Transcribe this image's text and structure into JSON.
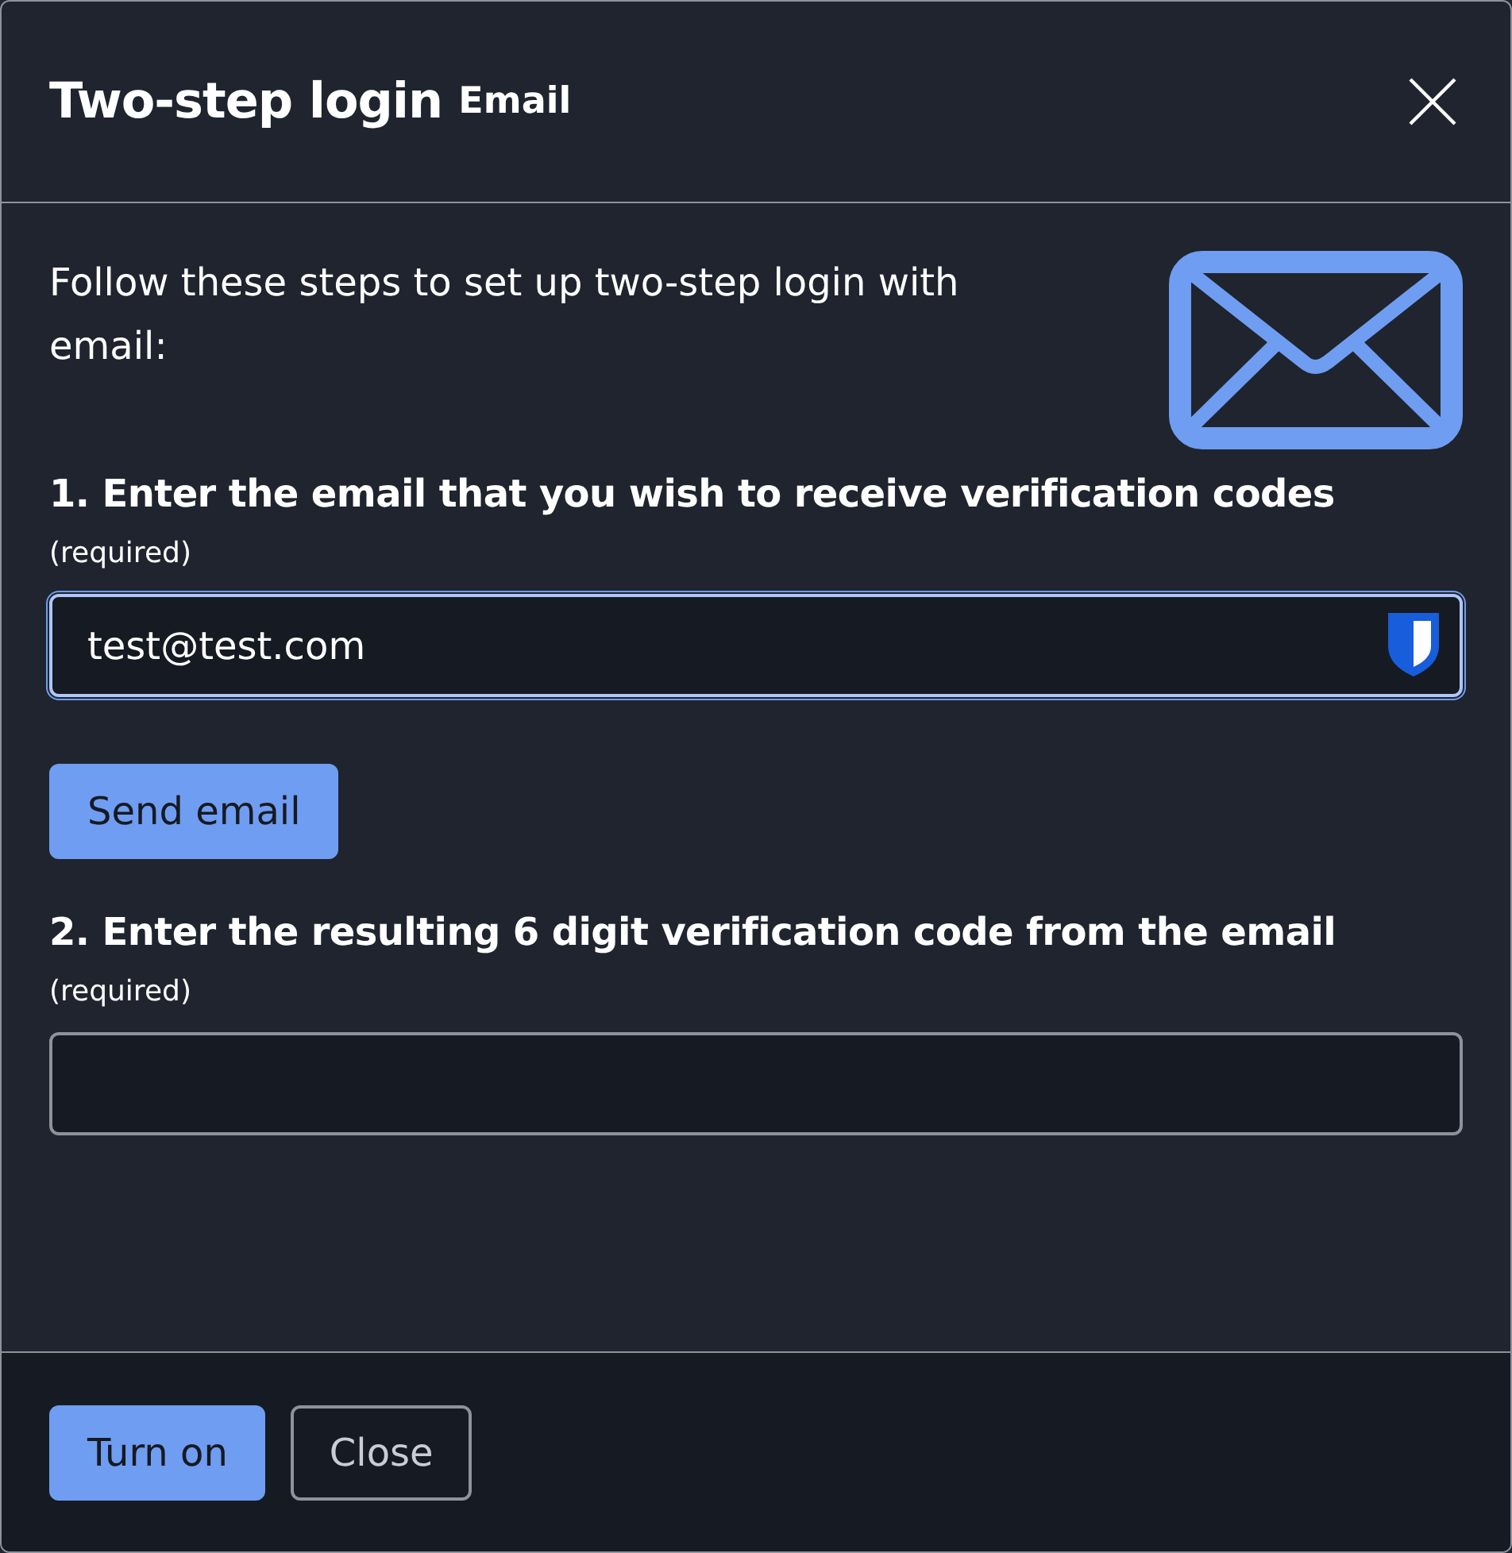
{
  "dialog": {
    "title": "Two-step login",
    "subtitle": "Email",
    "intro": "Follow these steps to set up two-step login with email:",
    "steps": [
      {
        "label": "1. Enter the email that you wish to receive verification codes",
        "hint": "(required)",
        "value": "test@test.com",
        "focused": true,
        "autofill_icon": true,
        "action": "Send email"
      },
      {
        "label": "2. Enter the resulting 6 digit verification code from the email",
        "hint": "(required)",
        "focused": false
      }
    ],
    "buttons": [
      {
        "label": "Turn on",
        "kind": "primary"
      },
      {
        "label": "Close",
        "kind": "secondary"
      }
    ]
  }
}
